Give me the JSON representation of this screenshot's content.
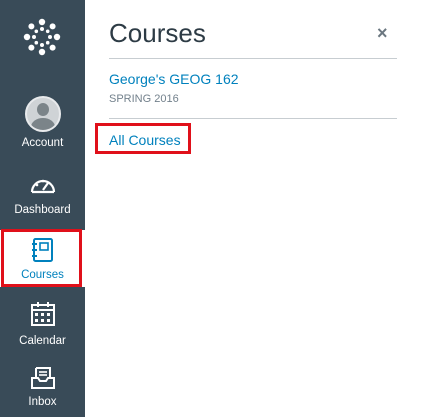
{
  "nav": {
    "logo": "canvas-logo-icon",
    "items": [
      {
        "label": "Account",
        "icon": "avatar-icon"
      },
      {
        "label": "Dashboard",
        "icon": "speedometer-icon"
      },
      {
        "label": "Courses",
        "icon": "book-icon",
        "active": true
      },
      {
        "label": "Calendar",
        "icon": "calendar-icon"
      },
      {
        "label": "Inbox",
        "icon": "inbox-icon"
      }
    ]
  },
  "panel": {
    "title": "Courses",
    "close": "×",
    "courses": [
      {
        "name": "George's GEOG 162",
        "term": "SPRING 2016"
      }
    ],
    "all_courses": "All Courses"
  },
  "colors": {
    "sidebar": "#394b58",
    "link": "#0081bd",
    "highlight": "#e0101a"
  }
}
